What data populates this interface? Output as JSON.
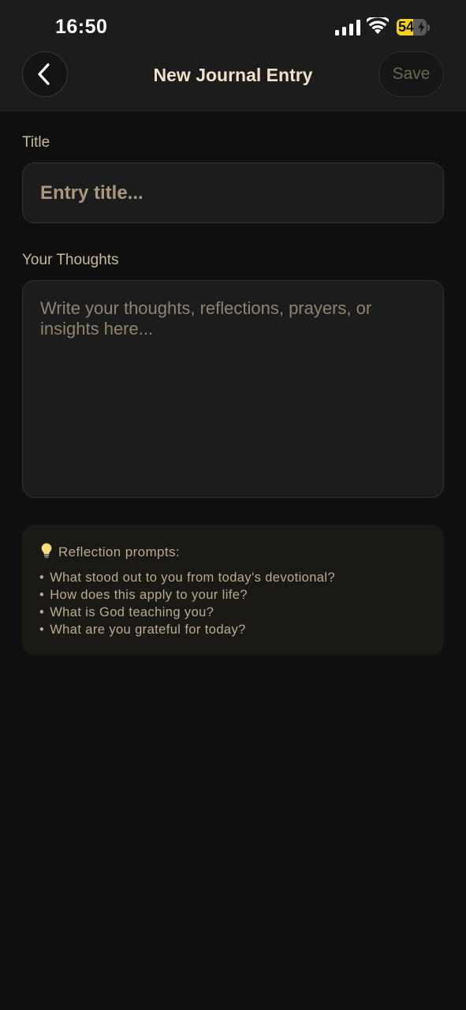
{
  "status_bar": {
    "time": "16:50",
    "battery_level": "54",
    "battery_percent": 54,
    "icons": [
      "signal-icon",
      "wifi-icon",
      "battery-charging-icon"
    ]
  },
  "header": {
    "back_icon": "chevron-left-icon",
    "title": "New Journal Entry",
    "save_label": "Save"
  },
  "form": {
    "title_label": "Title",
    "title_placeholder": "Entry title...",
    "thoughts_label": "Your Thoughts",
    "thoughts_placeholder": "Write your thoughts, reflections, prayers, or insights here..."
  },
  "prompts": {
    "icon": "lightbulb-icon",
    "heading": "Reflection prompts:",
    "items": [
      "What stood out to you from today's devotional?",
      "How does this apply to your life?",
      "What is God teaching you?",
      "What are you grateful for today?"
    ]
  },
  "colors": {
    "background": "#0f0f0f",
    "header_bg": "#1c1c1c",
    "accent_text": "#efe2c8",
    "muted_text": "#b9ab90",
    "battery": "#f3d21b"
  }
}
